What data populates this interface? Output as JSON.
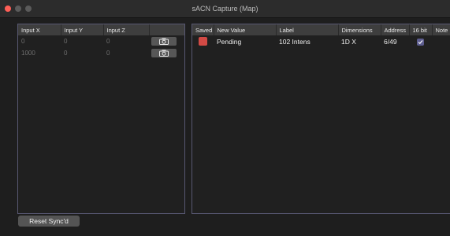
{
  "window": {
    "title": "sACN Capture (Map)",
    "close_color": "#ff5f57"
  },
  "input_table": {
    "columns": [
      "Input X",
      "Input Y",
      "Input Z",
      ""
    ],
    "rows": [
      {
        "x": "0",
        "y": "0",
        "z": "0",
        "action_icon": "camera-icon"
      },
      {
        "x": "1000",
        "y": "0",
        "z": "0",
        "action_icon": "camera-icon"
      }
    ]
  },
  "output_table": {
    "columns": [
      "Saved",
      "New Value",
      "Label",
      "Dimensions",
      "Address",
      "16 bit",
      "Note"
    ],
    "rows": [
      {
        "saved_color": "#d24a45",
        "new_value": "Pending",
        "label": "102 Intens",
        "dimensions": "1D X",
        "address": "6/49",
        "sixteen_bit": true
      }
    ]
  },
  "footer": {
    "reset_label": "Reset Sync'd"
  }
}
